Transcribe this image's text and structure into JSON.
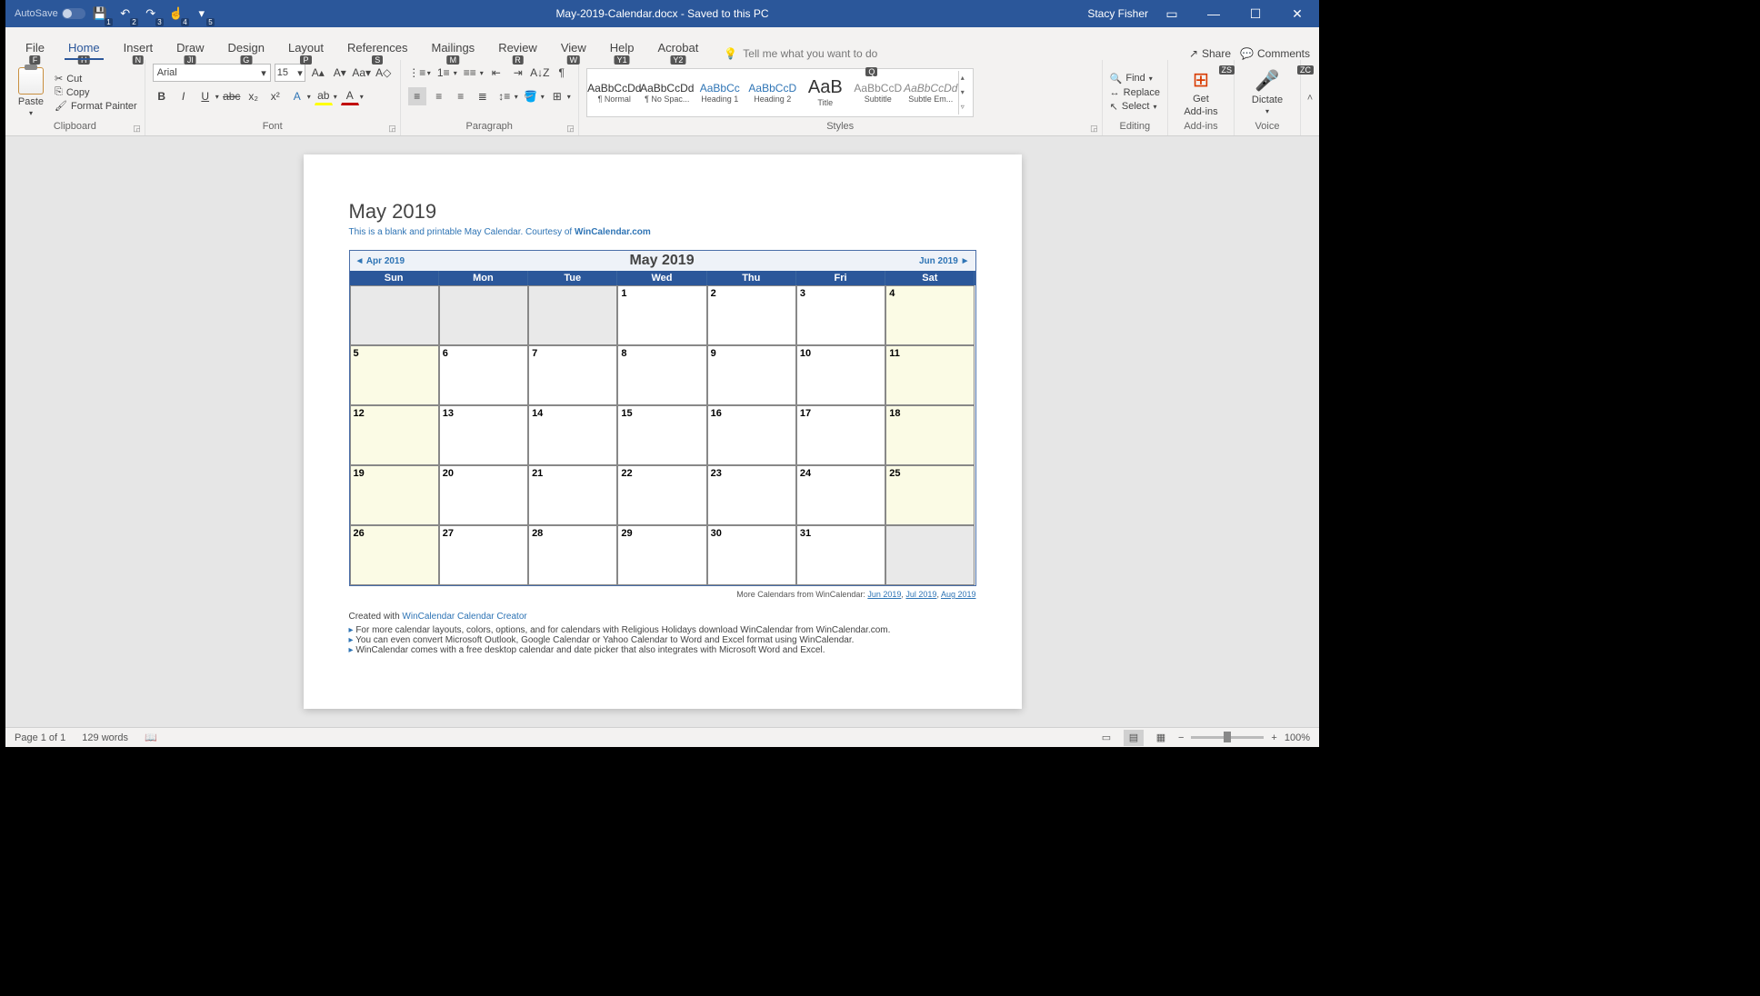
{
  "titlebar": {
    "autosave": "AutoSave",
    "doc_title": "May-2019-Calendar.docx - Saved to this PC",
    "user": "Stacy Fisher",
    "qat_keys": [
      "1",
      "2",
      "3",
      "4",
      "5"
    ]
  },
  "tabs": {
    "items": [
      {
        "label": "File",
        "key": "F"
      },
      {
        "label": "Home",
        "key": "H"
      },
      {
        "label": "Insert",
        "key": "N"
      },
      {
        "label": "Draw",
        "key": "JI"
      },
      {
        "label": "Design",
        "key": "G"
      },
      {
        "label": "Layout",
        "key": "P"
      },
      {
        "label": "References",
        "key": "S"
      },
      {
        "label": "Mailings",
        "key": "M"
      },
      {
        "label": "Review",
        "key": "R"
      },
      {
        "label": "View",
        "key": "W"
      },
      {
        "label": "Help",
        "key": "Y1"
      },
      {
        "label": "Acrobat",
        "key": "Y2"
      }
    ],
    "tellme": "Tell me what you want to do",
    "tellme_key": "Q",
    "share": "Share",
    "share_key": "ZS",
    "comments": "Comments",
    "comments_key": "ZC"
  },
  "ribbon": {
    "clipboard": {
      "paste": "Paste",
      "cut": "Cut",
      "copy": "Copy",
      "format_painter": "Format Painter",
      "label": "Clipboard"
    },
    "font": {
      "name": "Arial",
      "size": "15",
      "label": "Font"
    },
    "paragraph": {
      "label": "Paragraph"
    },
    "styles": {
      "label": "Styles",
      "items": [
        {
          "preview": "AaBbCcDd",
          "name": "¶ Normal"
        },
        {
          "preview": "AaBbCcDd",
          "name": "¶ No Spac..."
        },
        {
          "preview": "AaBbCc",
          "name": "Heading 1"
        },
        {
          "preview": "AaBbCcD",
          "name": "Heading 2"
        },
        {
          "preview": "AaB",
          "name": "Title"
        },
        {
          "preview": "AaBbCcD",
          "name": "Subtitle"
        },
        {
          "preview": "AaBbCcDd",
          "name": "Subtle Em..."
        }
      ]
    },
    "editing": {
      "find": "Find",
      "replace": "Replace",
      "select": "Select",
      "label": "Editing"
    },
    "addins": {
      "get": "Get",
      "addins": "Add-ins",
      "label": "Add-ins"
    },
    "voice": {
      "dictate": "Dictate",
      "label": "Voice"
    }
  },
  "document": {
    "title": "May 2019",
    "subtitle_1": "This is a blank and printable May Calendar.  Courtesy of ",
    "subtitle_link": "WinCalendar.com",
    "prev_month": "Apr 2019",
    "header_month": "May   2019",
    "next_month": "Jun 2019",
    "dow": [
      "Sun",
      "Mon",
      "Tue",
      "Wed",
      "Thu",
      "Fri",
      "Sat"
    ],
    "weeks": [
      [
        "",
        "",
        "",
        "1",
        "2",
        "3",
        "4"
      ],
      [
        "5",
        "6",
        "7",
        "8",
        "9",
        "10",
        "11"
      ],
      [
        "12",
        "13",
        "14",
        "15",
        "16",
        "17",
        "18"
      ],
      [
        "19",
        "20",
        "21",
        "22",
        "23",
        "24",
        "25"
      ],
      [
        "26",
        "27",
        "28",
        "29",
        "30",
        "31",
        ""
      ]
    ],
    "more_calendars": "More Calendars from WinCalendar: ",
    "more_links": [
      "Jun 2019",
      "Jul 2019",
      "Aug 2019"
    ],
    "created_with": "Created with ",
    "created_link": "WinCalendar Calendar Creator",
    "bullets": [
      "For more calendar layouts, colors, options, and for calendars with Religious Holidays download WinCalendar from WinCalendar.com.",
      "You can even convert Microsoft Outlook, Google Calendar or Yahoo Calendar to Word and Excel format using WinCalendar.",
      "WinCalendar comes with a free desktop calendar and date picker that also integrates with Microsoft Word and Excel."
    ]
  },
  "status": {
    "page": "Page 1 of 1",
    "words": "129 words",
    "zoom": "100%"
  }
}
